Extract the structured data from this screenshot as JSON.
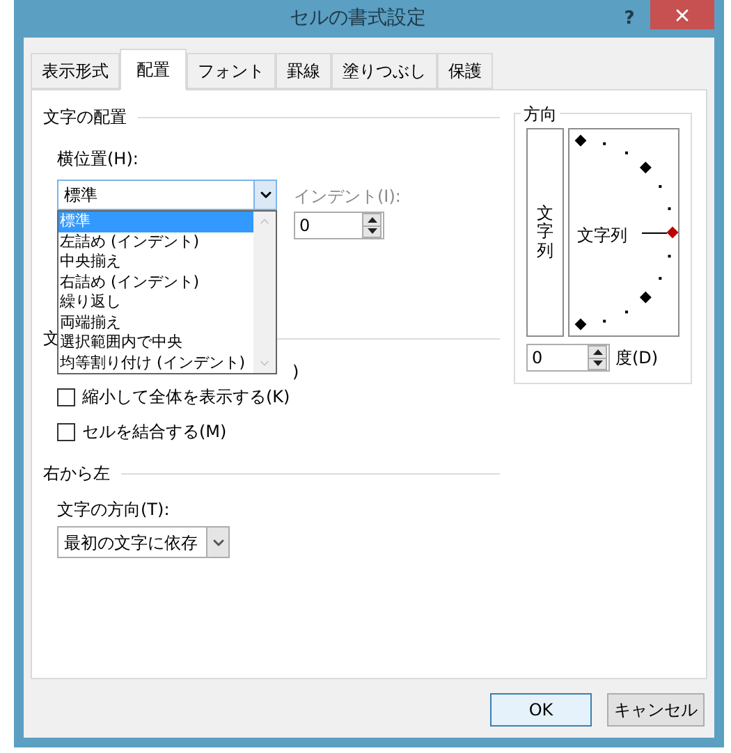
{
  "window": {
    "title": "セルの書式設定",
    "help": "?"
  },
  "tabs": [
    {
      "label": "表示形式",
      "selected": false
    },
    {
      "label": "配置",
      "selected": true
    },
    {
      "label": "フォント",
      "selected": false
    },
    {
      "label": "罫線",
      "selected": false
    },
    {
      "label": "塗りつぶし",
      "selected": false
    },
    {
      "label": "保護",
      "selected": false
    }
  ],
  "alignment": {
    "heading": "文字の配置",
    "horizontal": {
      "label": "横位置(H):",
      "value": "標準",
      "expanded": true,
      "options": [
        {
          "label": "標準",
          "selected": true
        },
        {
          "label": "左詰め (インデント)",
          "selected": false
        },
        {
          "label": "中央揃え",
          "selected": false
        },
        {
          "label": "右詰め (インデント)",
          "selected": false
        },
        {
          "label": "繰り返し",
          "selected": false
        },
        {
          "label": "両端揃え",
          "selected": false
        },
        {
          "label": "選択範囲内で中央",
          "selected": false
        },
        {
          "label": "均等割り付け (インデント)",
          "selected": false
        }
      ]
    },
    "indent": {
      "label": "インデント(I):",
      "value": "0",
      "disabled": true
    }
  },
  "text_control": {
    "heading": "文",
    "hidden_option_tail": ")",
    "options": [
      {
        "label": "縮小して全体を表示する(K)",
        "checked": false
      },
      {
        "label": "セルを結合する(M)",
        "checked": false
      }
    ]
  },
  "right_to_left": {
    "heading": "右から左",
    "direction": {
      "label": "文字の方向(T):",
      "value": "最初の文字に依存"
    }
  },
  "orientation": {
    "heading": "方向",
    "vertical_text": "文字列",
    "horizontal_text": "文字列",
    "degrees": "0",
    "degrees_label": "度(D)"
  },
  "buttons": [
    {
      "label": "OK",
      "default": true
    },
    {
      "label": "キャンセル",
      "default": false
    }
  ]
}
